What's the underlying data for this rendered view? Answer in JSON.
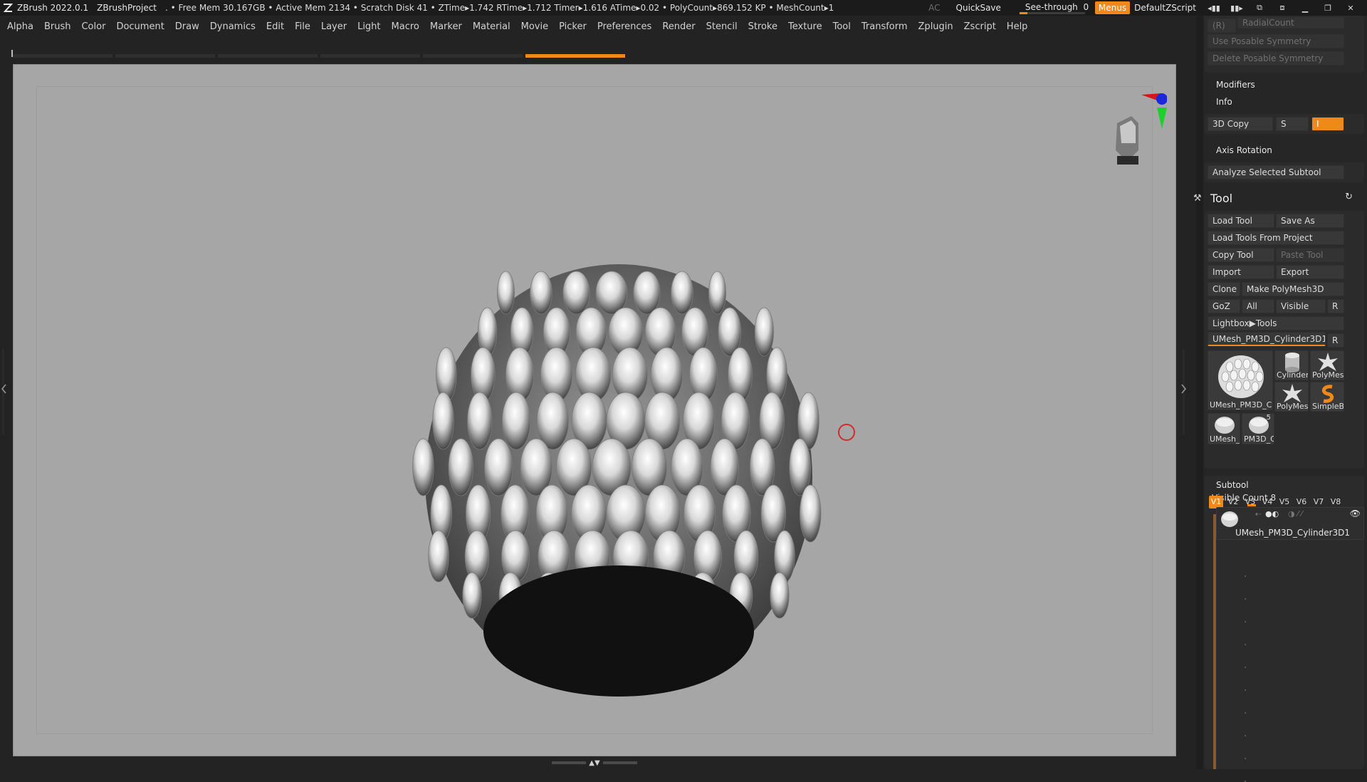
{
  "titlebar": {
    "app": "ZBrush 2022.0.1",
    "project": "ZBrushProject",
    "stats": ". • Free Mem 30.167GB • Active Mem 2134 • Scratch Disk 41 •  ZTime▸1.742 RTime▸1.712 Timer▸1.616 ATime▸0.02 • PolyCount▸869.152 KP  • MeshCount▸1",
    "ac": "AC",
    "quicksave": "QuickSave",
    "seethrough_label": "See-through",
    "seethrough_value": "0",
    "seethrough_level": 0.12,
    "menus": "Menus",
    "default_zscript": "DefaultZScript"
  },
  "menubar": [
    "Alpha",
    "Brush",
    "Color",
    "Document",
    "Draw",
    "Dynamics",
    "Edit",
    "File",
    "Layer",
    "Light",
    "Macro",
    "Marker",
    "Material",
    "Movie",
    "Picker",
    "Preferences",
    "Render",
    "Stencil",
    "Stroke",
    "Texture",
    "Tool",
    "Transform",
    "Zplugin",
    "Zscript",
    "Help"
  ],
  "colors": {
    "accent": "#f0881a",
    "viewport_bg": "#a6a6a6",
    "panel_bg": "#262626",
    "button_bg": "#383838"
  },
  "icons": {
    "app_logo": "zbrush-logo-icon",
    "tool": "hammer-icon",
    "reset": "reset-icon",
    "visible": "eye-icon"
  },
  "right_panel": {
    "r_label": "(R)",
    "radial_count": "RadialCount",
    "use_posable_symmetry": "Use Posable Symmetry",
    "delete_posable_symmetry": "Delete Posable Symmetry",
    "modifiers": "Modifiers",
    "info": "Info",
    "copy_3d": "3D Copy",
    "copy_s": "S",
    "copy_i": "I",
    "axis_rotation": "Axis Rotation",
    "analyze_selected_subtool": "Analyze Selected Subtool",
    "tool_title": "Tool",
    "load_tool": "Load Tool",
    "save_as": "Save As",
    "load_tools_from_project": "Load Tools From Project",
    "copy_tool": "Copy Tool",
    "paste_tool": "Paste Tool",
    "import": "Import",
    "export": "Export",
    "clone": "Clone",
    "make_polymesh3d": "Make PolyMesh3D",
    "goz": "GoZ",
    "all": "All",
    "visible": "Visible",
    "r": "R",
    "lightbox_tools": "Lightbox▶Tools",
    "current_tool": "UMesh_PM3D_Cylinder3D1.",
    "current_tool_r": "R",
    "thumbs": {
      "main": "UMesh_PM3D_C",
      "cylinder": "Cylinder",
      "polymesh_a": "PolyMes",
      "polymesh_b": "PolyMes",
      "simple": "SimpleB",
      "umesh_small": "UMesh_",
      "pm3d_small": "PM3D_C",
      "pm3d_small_num": "5"
    },
    "subtool": "Subtool",
    "visible_count": "Visible Count 8",
    "v_tabs": [
      "V1",
      "V2",
      "V3",
      "V4",
      "V5",
      "V6",
      "V7",
      "V8"
    ],
    "subtool_name": "UMesh_PM3D_Cylinder3D1"
  }
}
